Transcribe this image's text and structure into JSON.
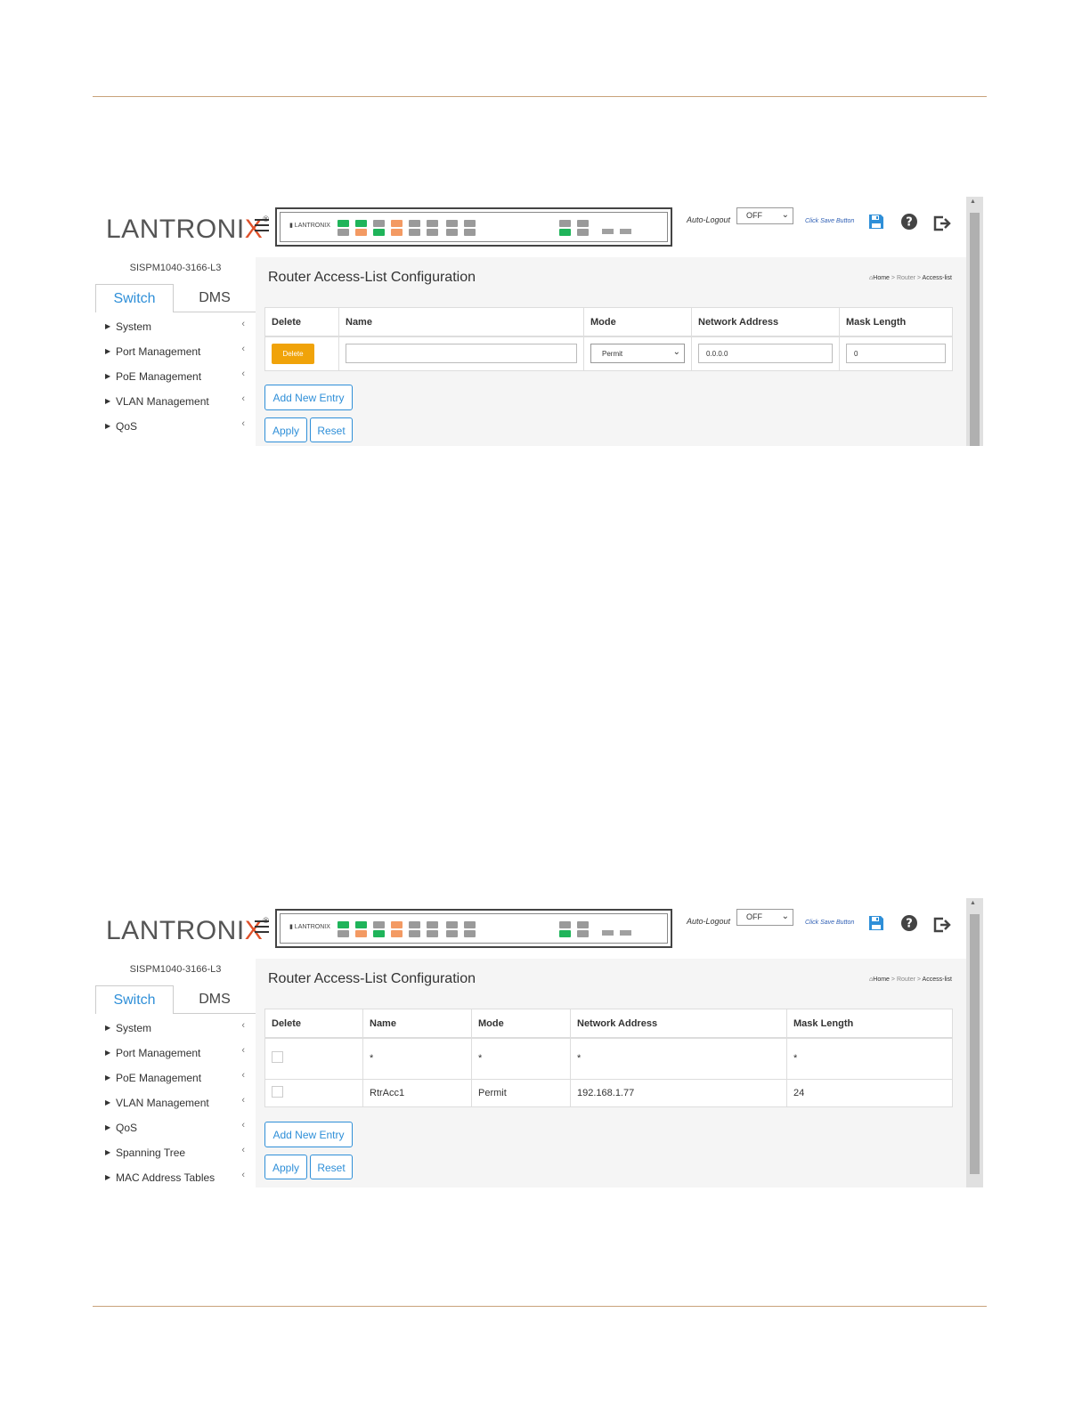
{
  "brand": {
    "logo_text": "LANTRONI",
    "logo_x": "X",
    "registered": "®"
  },
  "screens": [
    {
      "model": "SISPM1040-3166-L3",
      "tabs": [
        "Switch",
        "DMS"
      ],
      "menu": [
        "System",
        "Port Management",
        "PoE Management",
        "VLAN Management",
        "QoS"
      ],
      "auto_logout_label": "Auto-Logout",
      "auto_logout_value": "OFF",
      "click_save": "Click Save Button",
      "title": "Router Access-List Configuration",
      "breadcrumb": {
        "home": "Home",
        "section": "Router",
        "current": "Access-list"
      },
      "columns": [
        "Delete",
        "Name",
        "Mode",
        "Network Address",
        "Mask Length"
      ],
      "row": {
        "delete_label": "Delete",
        "name_value": "",
        "mode_value": "Permit",
        "network_value": "0.0.0.0",
        "mask_value": "0"
      },
      "add_new": "Add New Entry",
      "apply": "Apply",
      "reset": "Reset"
    },
    {
      "model": "SISPM1040-3166-L3",
      "tabs": [
        "Switch",
        "DMS"
      ],
      "menu": [
        "System",
        "Port Management",
        "PoE Management",
        "VLAN Management",
        "QoS",
        "Spanning Tree",
        "MAC Address Tables"
      ],
      "auto_logout_label": "Auto-Logout",
      "auto_logout_value": "OFF",
      "click_save": "Click Save Button",
      "title": "Router Access-List Configuration",
      "breadcrumb": {
        "home": "Home",
        "section": "Router",
        "current": "Access-list"
      },
      "columns": [
        "Delete",
        "Name",
        "Mode",
        "Network Address",
        "Mask Length"
      ],
      "rows": [
        {
          "name": "*",
          "mode": "*",
          "network": "*",
          "mask": "*"
        },
        {
          "name": "RtrAcc1",
          "mode": "Permit",
          "network": "192.168.1.77",
          "mask": "24"
        }
      ],
      "add_new": "Add New Entry",
      "apply": "Apply",
      "reset": "Reset"
    }
  ],
  "colors": {
    "accent": "#2f8fd8",
    "delete_button": "#f0a30a",
    "rule": "#c8a27a",
    "logo_x": "#e0512a"
  }
}
